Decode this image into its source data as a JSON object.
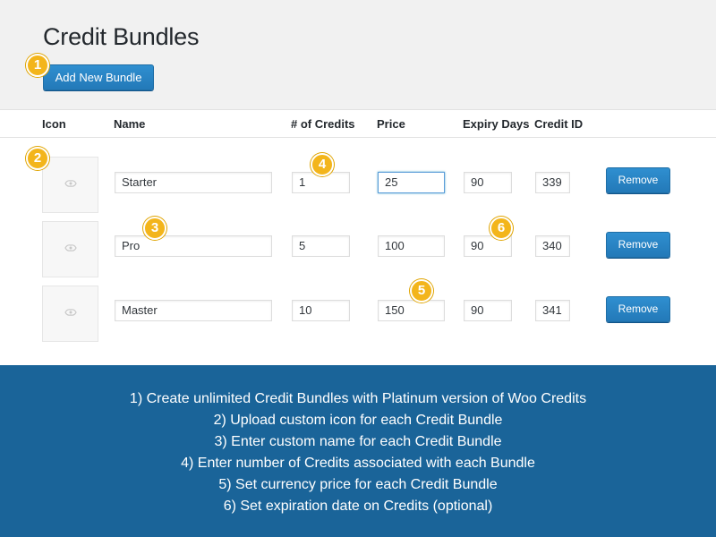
{
  "page_title": "Credit Bundles",
  "add_button_label": "Add New Bundle",
  "columns": {
    "icon": "Icon",
    "name": "Name",
    "credits": "# of Credits",
    "price": "Price",
    "expiry": "Expiry Days",
    "credit_id": "Credit ID"
  },
  "rows": [
    {
      "name": "Starter",
      "credits": "1",
      "price": "25",
      "expiry": "90",
      "credit_id": "339",
      "remove_label": "Remove"
    },
    {
      "name": "Pro",
      "credits": "5",
      "price": "100",
      "expiry": "90",
      "credit_id": "340",
      "remove_label": "Remove"
    },
    {
      "name": "Master",
      "credits": "10",
      "price": "150",
      "expiry": "90",
      "credit_id": "341",
      "remove_label": "Remove"
    }
  ],
  "badges": [
    "1",
    "2",
    "3",
    "4",
    "5",
    "6"
  ],
  "icons": [
    "placeholder-image-icon"
  ],
  "accent_color": "#2e8ccb",
  "badge_color": "#f3b51b",
  "footer_color": "#1a6499",
  "footer_lines": [
    "1) Create unlimited Credit Bundles with Platinum version of Woo Credits",
    "2) Upload custom icon for each Credit Bundle",
    "3) Enter custom name for each Credit Bundle",
    "4) Enter number of Credits associated with each Bundle",
    "5) Set currency price for each Credit Bundle",
    "6) Set expiration date on Credits (optional)"
  ]
}
